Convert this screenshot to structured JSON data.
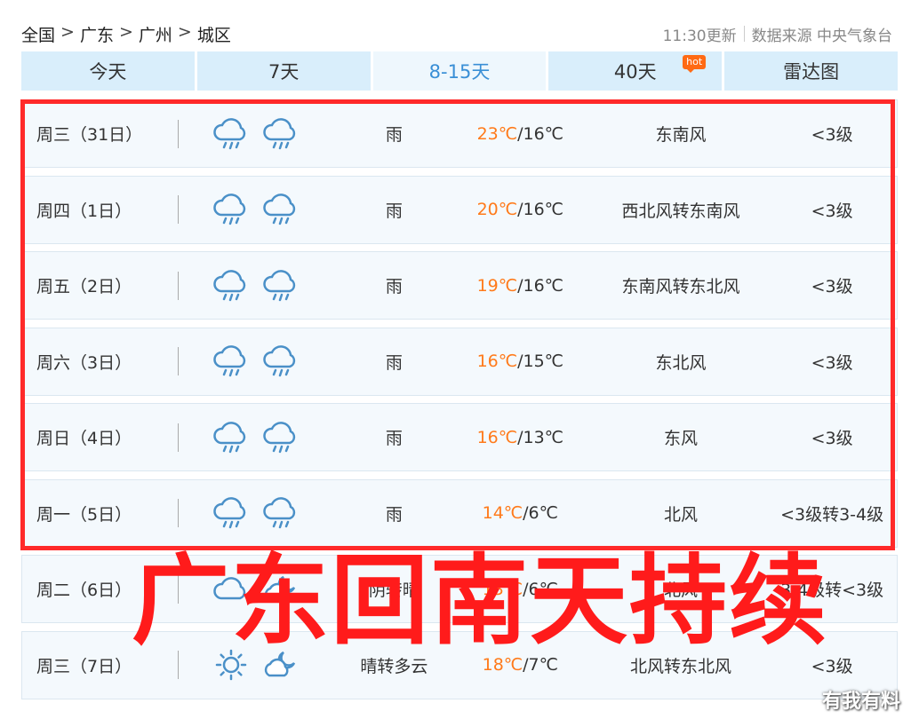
{
  "breadcrumb": [
    "全国",
    "广东",
    "广州",
    "城区"
  ],
  "breadcrumb_sep": ">",
  "meta": {
    "updated": "11:30更新",
    "source": "数据来源 中央气象台"
  },
  "tabs": [
    {
      "label": "今天"
    },
    {
      "label": "7天"
    },
    {
      "label": "8-15天",
      "active": true
    },
    {
      "label": "40天",
      "badge": "hot"
    },
    {
      "label": "雷达图"
    }
  ],
  "rows": [
    {
      "day": "周三（31日）",
      "icons": [
        "rain-cloud-icon",
        "rain-cloud-icon"
      ],
      "desc": "雨",
      "hi": "23℃",
      "lo": "/16℃",
      "wind": "东南风",
      "level": "<3级"
    },
    {
      "day": "周四（1日）",
      "icons": [
        "rain-cloud-icon",
        "rain-cloud-icon"
      ],
      "desc": "雨",
      "hi": "20℃",
      "lo": "/16℃",
      "wind": "西北风转东南风",
      "level": "<3级"
    },
    {
      "day": "周五（2日）",
      "icons": [
        "rain-cloud-icon",
        "rain-cloud-icon"
      ],
      "desc": "雨",
      "hi": "19℃",
      "lo": "/16℃",
      "wind": "东南风转东北风",
      "level": "<3级"
    },
    {
      "day": "周六（3日）",
      "icons": [
        "rain-cloud-icon",
        "rain-cloud-icon"
      ],
      "desc": "雨",
      "hi": "16℃",
      "lo": "/15℃",
      "wind": "东北风",
      "level": "<3级"
    },
    {
      "day": "周日（4日）",
      "icons": [
        "rain-cloud-icon",
        "rain-cloud-icon"
      ],
      "desc": "雨",
      "hi": "16℃",
      "lo": "/13℃",
      "wind": "东风",
      "level": "<3级"
    },
    {
      "day": "周一（5日）",
      "icons": [
        "rain-cloud-icon",
        "rain-cloud-icon"
      ],
      "desc": "雨",
      "hi": "14℃",
      "lo": "/6℃",
      "wind": "北风",
      "level": "<3级转3-4级"
    },
    {
      "day": "周二（6日）",
      "icons": [
        "cloud-icon",
        "moon-cloud-icon"
      ],
      "desc": "阴转晴",
      "hi": "13℃",
      "lo": "/6℃",
      "wind": "北风",
      "level": "3-4级转<3级"
    },
    {
      "day": "周三（7日）",
      "icons": [
        "sun-icon",
        "moon-cloud-icon"
      ],
      "desc": "晴转多云",
      "hi": "18℃",
      "lo": "/7℃",
      "wind": "北风转东北风",
      "level": "<3级"
    }
  ],
  "overlay": "广东回南天持续",
  "watermark": "有我有料",
  "colors": {
    "accent": "#3a8fd6",
    "hot": "#ff6a14",
    "highlight": "#ff2a2a",
    "temp_hi": "#ff7a1a",
    "icon": "#4a90c8"
  }
}
